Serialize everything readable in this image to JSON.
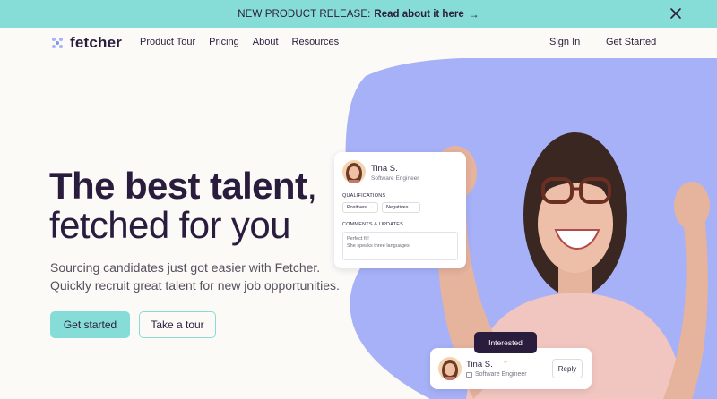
{
  "announcement": {
    "lead": "NEW PRODUCT RELEASE:",
    "link": "Read about it here",
    "arrow": "→",
    "close_icon": "close-icon"
  },
  "nav": {
    "logo_text": "fetcher",
    "logo_icon": "paw-dots-icon",
    "links": [
      "Product Tour",
      "Pricing",
      "About",
      "Resources"
    ],
    "sign_in": "Sign In",
    "get_started": "Get Started"
  },
  "hero": {
    "headline_bold": "The best talent",
    "headline_comma": ",",
    "headline_rest": "fetched for you",
    "subtext": "Sourcing candidates just got easier with Fetcher. Quickly recruit great talent for new job opportunities.",
    "cta_primary": "Get started",
    "cta_secondary": "Take a tour"
  },
  "profile_card": {
    "name": "Tina S.",
    "role": "Software Engineer",
    "qualifications_label": "QUALIFICATIONS",
    "positives": "Positives",
    "negatives": "Negatives",
    "comments_label": "COMMENTS & UPDATES",
    "comment_line1": "Perfect fit!",
    "comment_line2": "She speaks three languages."
  },
  "tooltip": {
    "label": "Interested"
  },
  "reply_card": {
    "name": "Tina S.",
    "role": "Software Engineer",
    "reply": "Reply"
  },
  "colors": {
    "accent": "#86dcd7",
    "ink": "#2a1c3d",
    "blob": "#a7b1f7",
    "background": "#fbfaf7"
  }
}
